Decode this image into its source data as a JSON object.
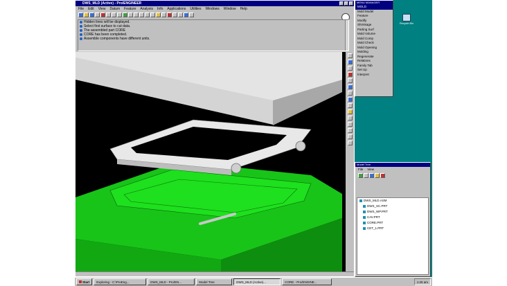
{
  "main_window": {
    "title": "DWS_MLD (Active) - Pro/ENGINEER",
    "menu": [
      "File",
      "Edit",
      "View",
      "Datum",
      "Feature",
      "Analysis",
      "Info",
      "Applications",
      "Utilities",
      "Windows",
      "Window",
      "Help"
    ],
    "messages": [
      "Hidden lines will be displayed.",
      "Select first surface to cut data.",
      "The assembled part CORE",
      "CORE has been completed.",
      "Assemble components have different units."
    ]
  },
  "mold_menu": {
    "title": "MENU MANAGER",
    "items": [
      "MOLD",
      "Mold Model",
      "Feature",
      "Modify",
      "Shrinkage",
      "Parting Surf",
      "Mold Volume",
      "Mold Comp",
      "Mold Check",
      "Mold Opening",
      "Molding",
      "Regenerate",
      "Relations",
      "Family Tab",
      "Set Up",
      "Interpret"
    ]
  },
  "model_tree": {
    "title": "Model Tree",
    "menu": [
      "File",
      "View"
    ],
    "items": [
      "DWS_MLD.ASM",
      "DWS_SC.PRT",
      "DWS_WP.PRT",
      "CAV.PRT",
      "CORE.PRT",
      "CET_1.PRT"
    ]
  },
  "taskbar": {
    "start": "Start",
    "tasks": [
      "Exploring - C:\\ProEng...",
      "DWS_MLD - Pro/EN...",
      "Model Tree",
      "DWS_MLD (Active)...",
      "CORE - Pro/ENGINE..."
    ],
    "pressed_index": 3,
    "clock": "1:25 am"
  },
  "desktop_icon": {
    "label": "Recycle Bin"
  },
  "colors": {
    "desktop": "#008080",
    "titlebar": "#000080",
    "viewport": "#000000",
    "mold_base": "#18c418",
    "plate": "#d6d6d6"
  }
}
